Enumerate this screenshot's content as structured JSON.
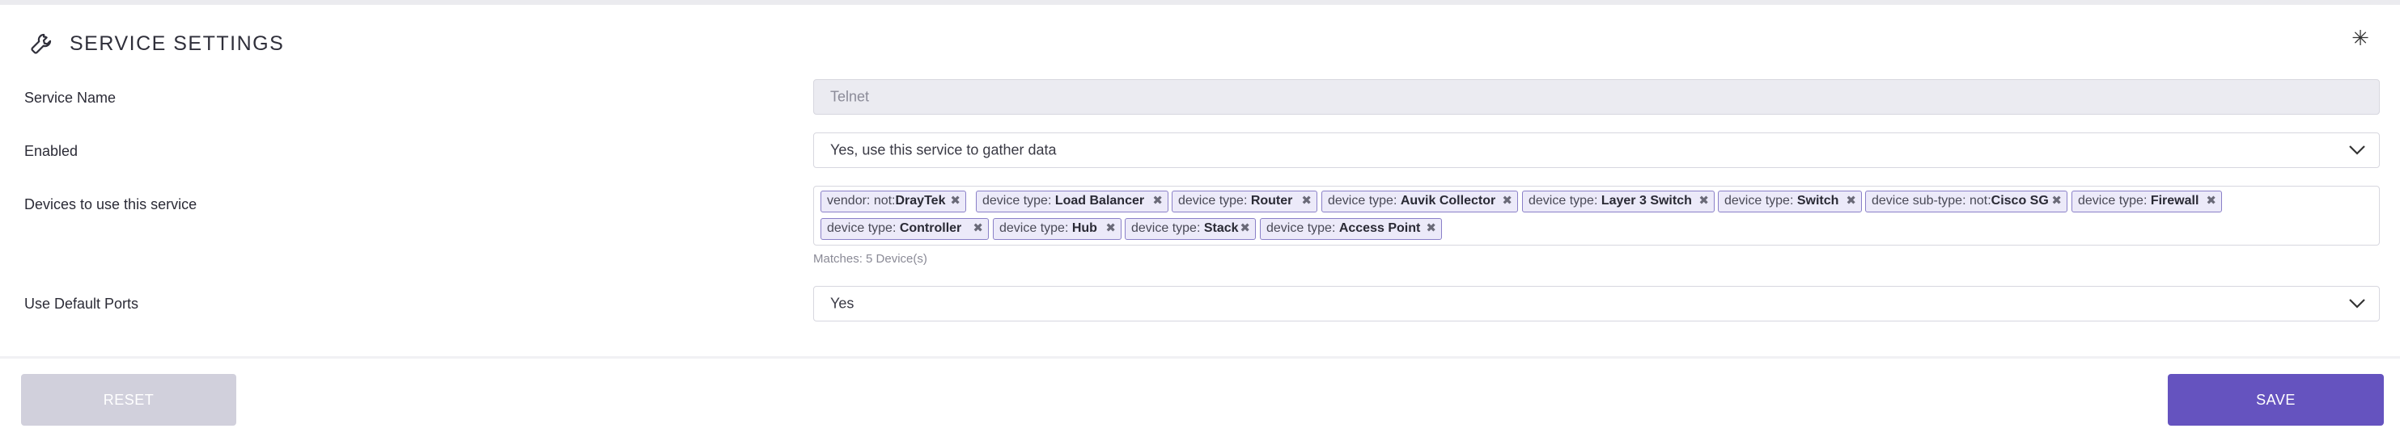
{
  "header": {
    "title": "SERVICE SETTINGS",
    "icon": "wrench-icon",
    "close_icon": "close-icon",
    "close_glyph": "✳"
  },
  "fields": {
    "service_name": {
      "label": "Service Name",
      "value": "Telnet"
    },
    "enabled": {
      "label": "Enabled",
      "value": "Yes, use this service to gather data"
    },
    "devices": {
      "label": "Devices to use this service",
      "tags": [
        {
          "key": "vendor: not:",
          "value": "DrayTek"
        },
        {
          "key": "device type: ",
          "value": "Load Balancer"
        },
        {
          "key": "device type: ",
          "value": "Router"
        },
        {
          "key": "device type: ",
          "value": "Auvik Collector"
        },
        {
          "key": "device type: ",
          "value": "Layer 3 Switch"
        },
        {
          "key": "device type: ",
          "value": "Switch"
        },
        {
          "key": "device sub-type: not:",
          "value": "Cisco SG"
        },
        {
          "key": "device type: ",
          "value": "Firewall"
        },
        {
          "key": "device type: ",
          "value": "Controller"
        },
        {
          "key": "device type: ",
          "value": "Hub"
        },
        {
          "key": "device type: ",
          "value": "Stack"
        },
        {
          "key": "device type: ",
          "value": "Access Point"
        }
      ],
      "remove_glyph": "✖",
      "matches": "Matches: 5 Device(s)"
    },
    "default_ports": {
      "label": "Use Default Ports",
      "value": "Yes"
    }
  },
  "buttons": {
    "reset": "RESET",
    "save": "SAVE"
  },
  "colors": {
    "accent": "#6553bf",
    "tag_border": "#8a80c8",
    "tag_bg": "#eceaf9",
    "disabled_bg": "#ebebf1"
  }
}
